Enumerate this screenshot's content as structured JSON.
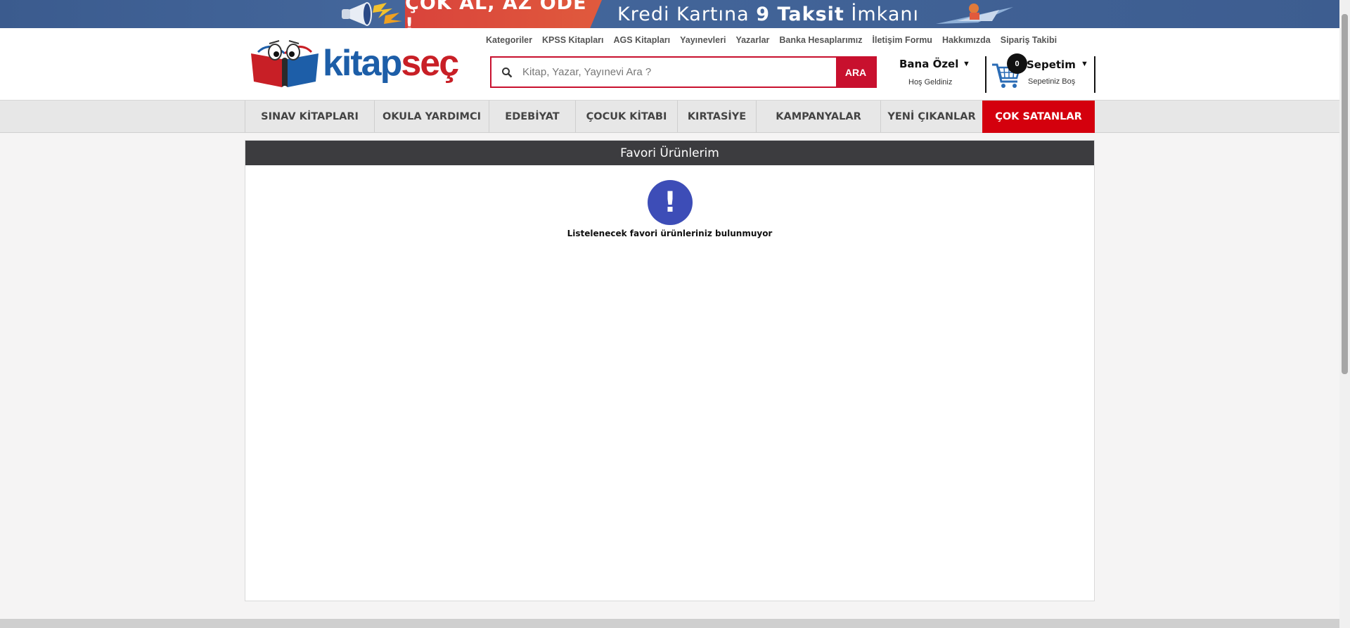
{
  "banner": {
    "promo_red": "ÇOK AL, AZ ÖDE !",
    "promo_text_a": "Kredi Kartına ",
    "promo_text_b": "9 Taksit",
    "promo_text_c": " İmkanı"
  },
  "header": {
    "logo_kit": "kitap",
    "logo_sec": "seç",
    "toplinks": [
      "Kategoriler",
      "KPSS Kitapları",
      "AGS Kitapları",
      "Yayınevleri",
      "Yazarlar",
      "Banka Hesaplarımız",
      "İletişim Formu",
      "Hakkımızda",
      "Sipariş Takibi"
    ],
    "search": {
      "placeholder": "Kitap, Yazar, Yayınevi Ara ?",
      "value": "",
      "button": "ARA"
    },
    "account": {
      "title": "Bana Özel",
      "subtitle": "Hoş Geldiniz"
    },
    "cart": {
      "count": "0",
      "title": "Sepetim",
      "subtitle": "Sepetiniz Boş"
    }
  },
  "nav": {
    "items": [
      "SINAV KİTAPLARI",
      "OKULA YARDIMCI",
      "EDEBİYAT",
      "ÇOCUK KİTABI",
      "KIRTASİYE",
      "KAMPANYALAR",
      "YENİ ÇIKANLAR",
      "ÇOK SATANLAR"
    ]
  },
  "favorites": {
    "title": "Favori Ürünlerim",
    "empty_icon_glyph": "!",
    "empty_message": "Listelenecek favori ürünleriniz bulunmuyor"
  },
  "colors": {
    "brand_red": "#c8102e",
    "brand_blue": "#1d5ea8",
    "hot_nav": "#d4000d",
    "panel_header": "#3c3c3f",
    "alert_icon": "#3d4db7"
  }
}
